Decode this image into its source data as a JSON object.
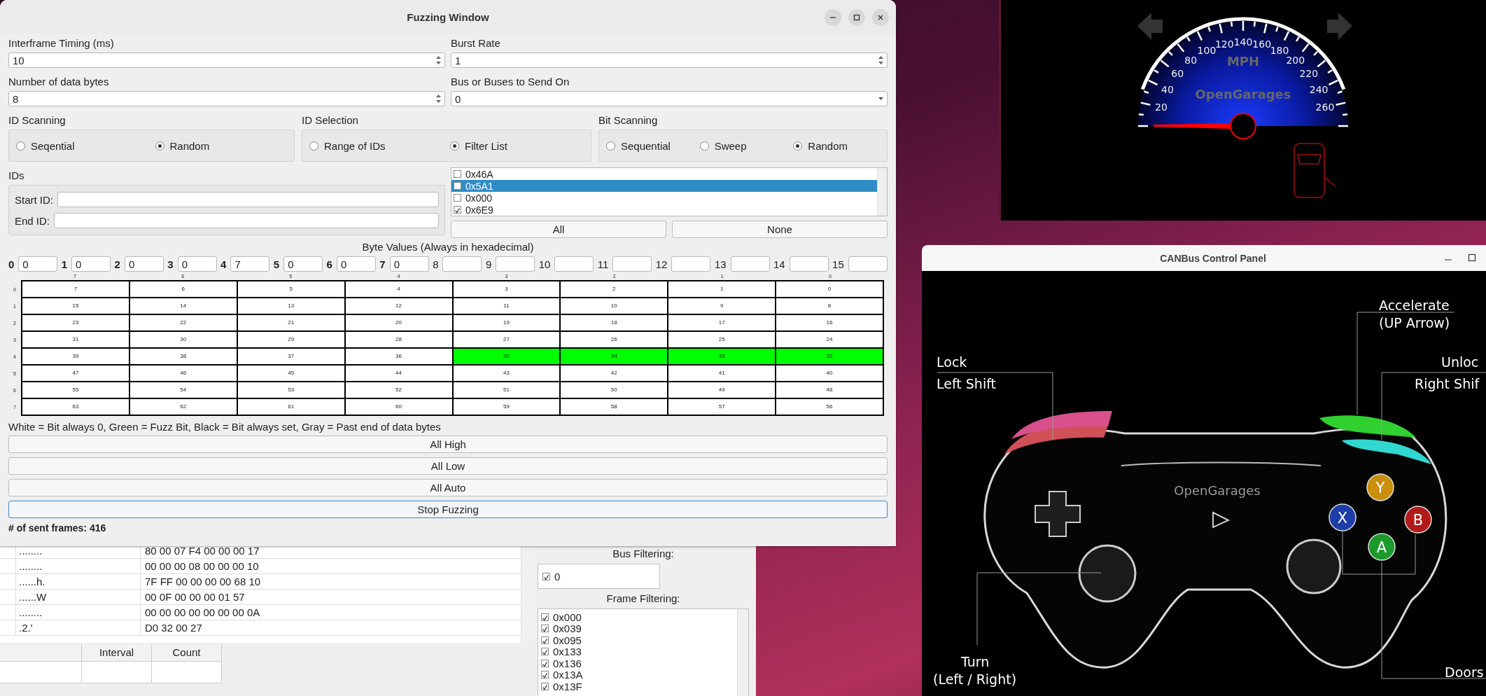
{
  "fuzzing_window": {
    "title": "Fuzzing Window",
    "fields": [
      {
        "label": "Interframe Timing (ms)",
        "value": "10",
        "kind": "spin"
      },
      {
        "label": "Burst Rate",
        "value": "1",
        "kind": "spin"
      },
      {
        "label": "Number of data bytes",
        "value": "8",
        "kind": "spin"
      },
      {
        "label": "Bus or Buses to Send On",
        "value": "0",
        "kind": "combo"
      }
    ],
    "groups": [
      {
        "label": "ID Scanning",
        "options": [
          {
            "label": "Seqential",
            "selected": false
          },
          {
            "label": "Random",
            "selected": true
          }
        ]
      },
      {
        "label": "ID Selection",
        "options": [
          {
            "label": "Range of IDs",
            "selected": false
          },
          {
            "label": "Filter List",
            "selected": true
          }
        ]
      },
      {
        "label": "Bit Scanning",
        "options": [
          {
            "label": "Sequential",
            "selected": false
          },
          {
            "label": "Sweep",
            "selected": false
          },
          {
            "label": "Random",
            "selected": true
          }
        ]
      }
    ],
    "ids": {
      "label": "IDs",
      "start_label": "Start ID:",
      "end_label": "End ID:"
    },
    "id_list": [
      {
        "label": "0x46A",
        "checked": false,
        "selected": false
      },
      {
        "label": "0x5A1",
        "checked": false,
        "selected": true
      },
      {
        "label": "0x000",
        "checked": false,
        "selected": false
      },
      {
        "label": "0x6E9",
        "checked": true,
        "selected": false
      }
    ],
    "list_buttons": [
      "All",
      "None"
    ],
    "byte_values": {
      "title": "Byte Values (Always in hexadecimal)",
      "bytes": [
        {
          "index": "0",
          "value": "0",
          "active": true
        },
        {
          "index": "1",
          "value": "0",
          "active": true
        },
        {
          "index": "2",
          "value": "0",
          "active": true
        },
        {
          "index": "3",
          "value": "0",
          "active": true
        },
        {
          "index": "4",
          "value": "7",
          "active": true
        },
        {
          "index": "5",
          "value": "0",
          "active": true
        },
        {
          "index": "6",
          "value": "0",
          "active": true
        },
        {
          "index": "7",
          "value": "0",
          "active": true
        },
        {
          "index": "8",
          "active": false
        },
        {
          "index": "9",
          "active": false
        },
        {
          "index": "10",
          "active": false
        },
        {
          "index": "11",
          "active": false
        },
        {
          "index": "12",
          "active": false
        },
        {
          "index": "13",
          "active": false
        },
        {
          "index": "14",
          "active": false
        },
        {
          "index": "15",
          "active": false
        }
      ]
    },
    "bit_grid": {
      "column_headers": [
        "7",
        "6",
        "5",
        "4",
        "3",
        "2",
        "1",
        "0"
      ],
      "row_headers": [
        "0",
        "1",
        "2",
        "3",
        "4",
        "5",
        "6",
        "7"
      ],
      "rows": [
        [
          {
            "text": "7",
            "fuzz": false
          },
          {
            "text": "6",
            "fuzz": false
          },
          {
            "text": "5",
            "fuzz": false
          },
          {
            "text": "4",
            "fuzz": false
          },
          {
            "text": "3",
            "fuzz": false
          },
          {
            "text": "2",
            "fuzz": false
          },
          {
            "text": "1",
            "fuzz": false
          },
          {
            "text": "0",
            "fuzz": false
          }
        ],
        [
          {
            "text": "15",
            "fuzz": false
          },
          {
            "text": "14",
            "fuzz": false
          },
          {
            "text": "13",
            "fuzz": false
          },
          {
            "text": "12",
            "fuzz": false
          },
          {
            "text": "11",
            "fuzz": false
          },
          {
            "text": "10",
            "fuzz": false
          },
          {
            "text": "9",
            "fuzz": false
          },
          {
            "text": "8",
            "fuzz": false
          }
        ],
        [
          {
            "text": "23",
            "fuzz": false
          },
          {
            "text": "22",
            "fuzz": false
          },
          {
            "text": "21",
            "fuzz": false
          },
          {
            "text": "20",
            "fuzz": false
          },
          {
            "text": "19",
            "fuzz": false
          },
          {
            "text": "18",
            "fuzz": false
          },
          {
            "text": "17",
            "fuzz": false
          },
          {
            "text": "16",
            "fuzz": false
          }
        ],
        [
          {
            "text": "31",
            "fuzz": false
          },
          {
            "text": "30",
            "fuzz": false
          },
          {
            "text": "29",
            "fuzz": false
          },
          {
            "text": "28",
            "fuzz": false
          },
          {
            "text": "27",
            "fuzz": false
          },
          {
            "text": "26",
            "fuzz": false
          },
          {
            "text": "25",
            "fuzz": false
          },
          {
            "text": "24",
            "fuzz": false
          }
        ],
        [
          {
            "text": "39",
            "fuzz": false
          },
          {
            "text": "38",
            "fuzz": false
          },
          {
            "text": "37",
            "fuzz": false
          },
          {
            "text": "36",
            "fuzz": false
          },
          {
            "text": "35",
            "fuzz": true
          },
          {
            "text": "34",
            "fuzz": true
          },
          {
            "text": "33",
            "fuzz": true
          },
          {
            "text": "32",
            "fuzz": true
          }
        ],
        [
          {
            "text": "47",
            "fuzz": false
          },
          {
            "text": "46",
            "fuzz": false
          },
          {
            "text": "45",
            "fuzz": false
          },
          {
            "text": "44",
            "fuzz": false
          },
          {
            "text": "43",
            "fuzz": false
          },
          {
            "text": "42",
            "fuzz": false
          },
          {
            "text": "41",
            "fuzz": false
          },
          {
            "text": "40",
            "fuzz": false
          }
        ],
        [
          {
            "text": "55",
            "fuzz": false
          },
          {
            "text": "54",
            "fuzz": false
          },
          {
            "text": "53",
            "fuzz": false
          },
          {
            "text": "52",
            "fuzz": false
          },
          {
            "text": "51",
            "fuzz": false
          },
          {
            "text": "50",
            "fuzz": false
          },
          {
            "text": "49",
            "fuzz": false
          },
          {
            "text": "48",
            "fuzz": false
          }
        ],
        [
          {
            "text": "63",
            "fuzz": false
          },
          {
            "text": "62",
            "fuzz": false
          },
          {
            "text": "61",
            "fuzz": false
          },
          {
            "text": "60",
            "fuzz": false
          },
          {
            "text": "59",
            "fuzz": false
          },
          {
            "text": "58",
            "fuzz": false
          },
          {
            "text": "57",
            "fuzz": false
          },
          {
            "text": "56",
            "fuzz": false
          }
        ]
      ]
    },
    "legend": "White = Bit always 0, Green = Fuzz Bit, Black = Bit always set, Gray = Past end of data bytes",
    "buttons": [
      {
        "label": "All High",
        "focused": false
      },
      {
        "label": "All Low",
        "focused": false
      },
      {
        "label": "All Auto",
        "focused": false
      },
      {
        "label": "Stop Fuzzing",
        "focused": true
      }
    ],
    "sent_frames": "# of sent frames: 416"
  },
  "speedometer": {
    "ticks": [
      "20",
      "40",
      "60",
      "80",
      "100",
      "120",
      "140",
      "160",
      "180",
      "200",
      "220",
      "240",
      "260"
    ],
    "unit": "MPH",
    "brand": "OpenGarages"
  },
  "control_panel": {
    "title": "CANBus Control Panel",
    "labels": [
      "Accelerate",
      "(UP Arrow)",
      "Lock",
      "Left Shift",
      "Unloc",
      "Right Shif",
      "Turn",
      "(Left / Right)",
      "Doors"
    ],
    "brand": "OpenGarages",
    "face_buttons": [
      {
        "label": "Y",
        "color": "#c98f0c"
      },
      {
        "label": "X",
        "color": "#1d3da8"
      },
      {
        "label": "B",
        "color": "#b31a1a"
      },
      {
        "label": "A",
        "color": "#1d9a2c"
      }
    ]
  },
  "background_window": {
    "frames": [
      {
        "ascii": "........",
        "data": "80 00 07 F4 00 00 00 17"
      },
      {
        "ascii": "........",
        "data": "00 00 00 08 00 00 00 10"
      },
      {
        "ascii": "......h.",
        "data": "7F FF 00 00 00 00 68 10"
      },
      {
        "ascii": "......W",
        "data": "00 0F 00 00 00 01 57"
      },
      {
        "ascii": "........",
        "data": "00 00 00 00 00 00 00 0A"
      },
      {
        "ascii": ".2.'",
        "data": "D0 32 00 27"
      }
    ],
    "table_columns": [
      "Interval",
      "Count"
    ],
    "bus_filtering": {
      "title": "Bus Filtering:",
      "items": [
        {
          "label": "0",
          "checked": true
        }
      ]
    },
    "frame_filtering": {
      "title": "Frame Filtering:",
      "items": [
        {
          "label": "0x000",
          "checked": true
        },
        {
          "label": "0x039",
          "checked": true
        },
        {
          "label": "0x095",
          "checked": true
        },
        {
          "label": "0x133",
          "checked": true
        },
        {
          "label": "0x136",
          "checked": true
        },
        {
          "label": "0x13A",
          "checked": true
        },
        {
          "label": "0x13F",
          "checked": true
        }
      ]
    }
  }
}
